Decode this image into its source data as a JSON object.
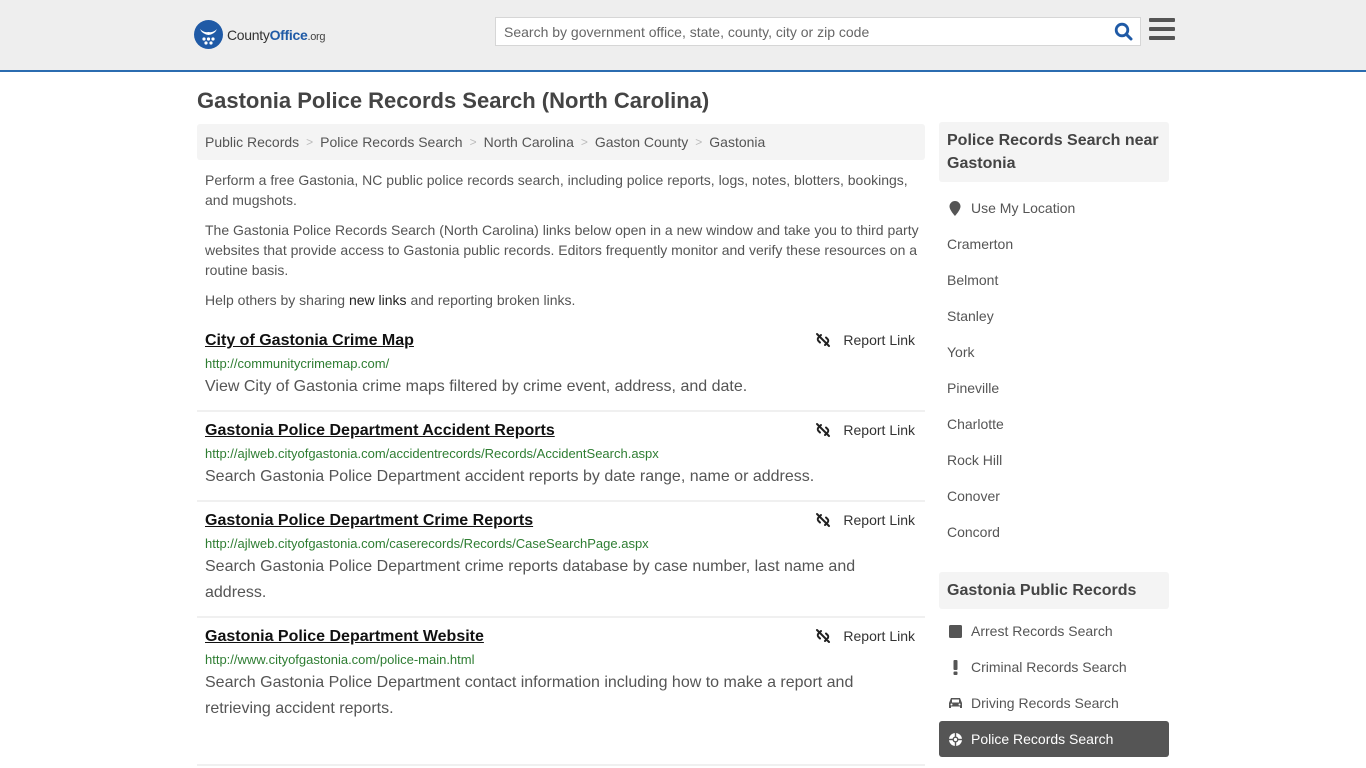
{
  "header": {
    "logo": {
      "name_part1": "County",
      "name_part2": "Office",
      "tld": ".org"
    },
    "search": {
      "placeholder": "Search by government office, state, county, city or zip code",
      "value": ""
    },
    "icons": {
      "search": "search-icon",
      "menu": "hamburger-menu-icon"
    }
  },
  "page": {
    "title": "Gastonia Police Records Search (North Carolina)"
  },
  "breadcrumb": [
    {
      "label": "Public Records"
    },
    {
      "label": "Police Records Search"
    },
    {
      "label": "North Carolina"
    },
    {
      "label": "Gaston County"
    },
    {
      "label": "Gastonia"
    }
  ],
  "intro": {
    "p1": "Perform a free Gastonia, NC public police records search, including police reports, logs, notes, blotters, bookings, and mugshots.",
    "p2": "The Gastonia Police Records Search (North Carolina) links below open in a new window and take you to third party websites that provide access to Gastonia public records. Editors frequently monitor and verify these resources on a routine basis.",
    "p3_before": "Help others by sharing ",
    "p3_link": "new links",
    "p3_after": " and reporting broken links."
  },
  "results": [
    {
      "title": "City of Gastonia Crime Map",
      "url": "http://communitycrimemap.com/",
      "description": "View City of Gastonia crime maps filtered by crime event, address, and date.",
      "report_label": "Report Link"
    },
    {
      "title": "Gastonia Police Department Accident Reports",
      "url": "http://ajlweb.cityofgastonia.com/accidentrecords/Records/AccidentSearch.aspx",
      "description": "Search Gastonia Police Department accident reports by date range, name or address.",
      "report_label": "Report Link"
    },
    {
      "title": "Gastonia Police Department Crime Reports",
      "url": "http://ajlweb.cityofgastonia.com/caserecords/Records/CaseSearchPage.aspx",
      "description": "Search Gastonia Police Department crime reports database by case number, last name and address.",
      "report_label": "Report Link"
    },
    {
      "title": "Gastonia Police Department Website",
      "url": "http://www.cityofgastonia.com/police-main.html",
      "description": "Search Gastonia Police Department contact information including how to make a report and retrieving accident reports.",
      "report_label": "Report Link"
    }
  ],
  "sidebar": {
    "nearby": {
      "heading": "Police Records Search near Gastonia",
      "use_location": "Use My Location",
      "cities": [
        "Cramerton",
        "Belmont",
        "Stanley",
        "York",
        "Pineville",
        "Charlotte",
        "Rock Hill",
        "Conover",
        "Concord"
      ]
    },
    "public_records": {
      "heading": "Gastonia Public Records",
      "items": [
        {
          "label": "Arrest Records Search",
          "icon": "square-icon",
          "active": false
        },
        {
          "label": "Criminal Records Search",
          "icon": "exclamation-icon",
          "active": false
        },
        {
          "label": "Driving Records Search",
          "icon": "car-icon",
          "active": false
        },
        {
          "label": "Police Records Search",
          "icon": "crosshair-icon",
          "active": true
        }
      ]
    }
  },
  "colors": {
    "accent": "#1f5aa6",
    "header_bg": "#eeeeee",
    "url_green": "#2e7d32",
    "active_bg": "#555555"
  }
}
